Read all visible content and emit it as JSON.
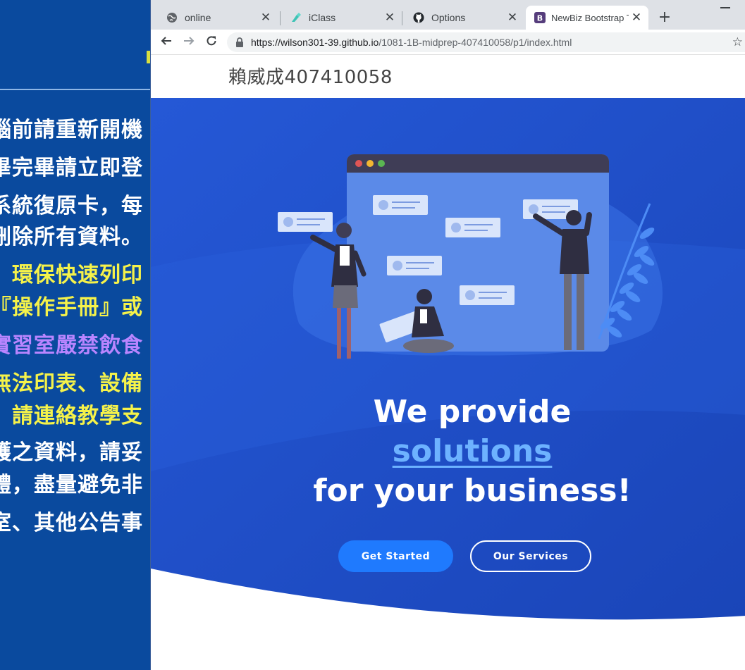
{
  "desktop_notice": {
    "lines": [
      "腦前請重新開機",
      "畢完畢請立即登",
      "系統復原卡，每",
      "刪除所有資料。",
      "、環保快速列印",
      "『操作手冊』或",
      "實習室嚴禁飲食",
      "無法印表、設備",
      "，請連絡教學支",
      "護之資料，請妥",
      "體，盡量避免非",
      "室、其他公告事"
    ]
  },
  "browser": {
    "tabs": [
      {
        "title": "online",
        "icon": "globe-icon"
      },
      {
        "title": "iClass",
        "icon": "iclass-icon"
      },
      {
        "title": "Options",
        "icon": "github-icon"
      },
      {
        "title": "NewBiz Bootstrap T",
        "icon": "bootstrap-icon",
        "active": true
      }
    ],
    "new_tab_label": "+",
    "close_glyph": "✕",
    "url_host": "https://wilson301-39.github.io",
    "url_path": "/1081-1B-midprep-407410058/p1/index.html"
  },
  "page": {
    "owner": "賴威成407410058",
    "hero": {
      "line1": "We provide",
      "line2": "solutions",
      "line3": "for your business!",
      "primary_button": "Get Started",
      "secondary_button": "Our Services"
    }
  },
  "colors": {
    "hero_blue": "#1e4fc7",
    "accent": "#1f7afe",
    "highlight": "#6db2ff"
  }
}
